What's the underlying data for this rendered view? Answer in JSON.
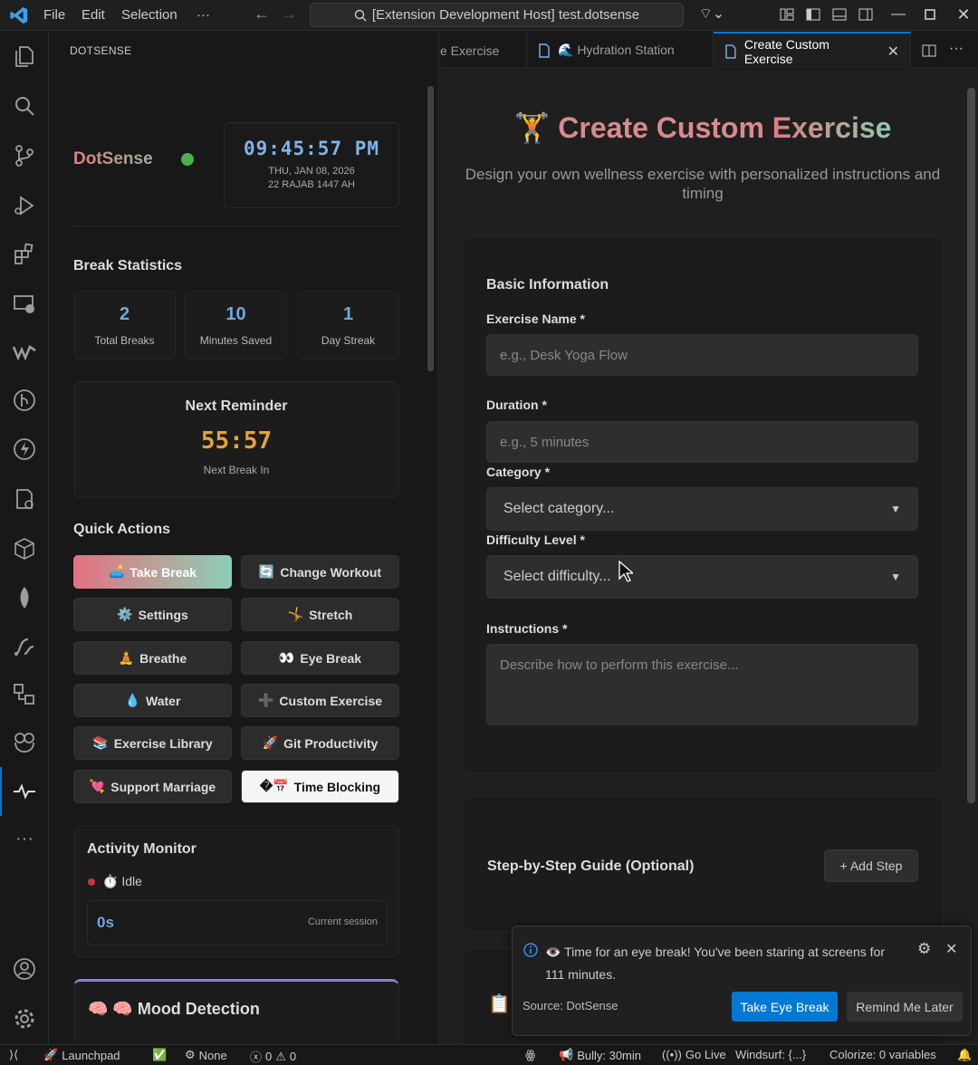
{
  "titlebar": {
    "menu": [
      "File",
      "Edit",
      "Selection",
      "···"
    ],
    "search": "[Extension Development Host] test.dotsense"
  },
  "sidebar": {
    "title": "DOTSENSE",
    "brand": "DotSense",
    "clock": {
      "time": "09:45:57 PM",
      "date": "THU, JAN 08, 2026",
      "hijri": "22 RAJAB 1447 AH"
    },
    "stats_title": "Break Statistics",
    "stats": [
      {
        "value": "2",
        "label": "Total Breaks"
      },
      {
        "value": "10",
        "label": "Minutes Saved"
      },
      {
        "value": "1",
        "label": "Day Streak"
      }
    ],
    "next": {
      "title": "Next Reminder",
      "countdown": "55:57",
      "sub": "Next Break In"
    },
    "quick_title": "Quick Actions",
    "quick": [
      {
        "icon": "🛋️",
        "label": "Take Break"
      },
      {
        "icon": "🔄",
        "label": "Change Workout"
      },
      {
        "icon": "⚙️",
        "label": "Settings"
      },
      {
        "icon": "🤸",
        "label": "Stretch"
      },
      {
        "icon": "🧘",
        "label": "Breathe"
      },
      {
        "icon": "👀",
        "label": "Eye Break"
      },
      {
        "icon": "💧",
        "label": "Water"
      },
      {
        "icon": "➕",
        "label": "Custom Exercise"
      },
      {
        "icon": "📚",
        "label": "Exercise Library"
      },
      {
        "icon": "🚀",
        "label": "Git Productivity"
      },
      {
        "icon": "💘",
        "label": "Support Marriage"
      },
      {
        "icon": "�📅",
        "label": "Time Blocking"
      }
    ],
    "activity": {
      "title": "Activity Monitor",
      "status": "⏱️ Idle",
      "session_value": "0s",
      "session_label": "Current session"
    },
    "mood_title": "🧠 🧠 Mood Detection"
  },
  "tabs": [
    {
      "label": "e Exercise"
    },
    {
      "label": "🌊 Hydration Station"
    },
    {
      "label": "Create Custom Exercise"
    }
  ],
  "editor": {
    "title_plain": "Create Custom ",
    "title_grad": "Exercise",
    "subtitle": "Design your own wellness exercise with personalized instructions and timing",
    "section": "Basic Information",
    "name_label": "Exercise Name *",
    "name_placeholder": "e.g., Desk Yoga Flow",
    "duration_label": "Duration *",
    "duration_placeholder": "e.g., 5 minutes",
    "category_label": "Category *",
    "category_value": "Select category...",
    "difficulty_label": "Difficulty Level *",
    "difficulty_value": "Select difficulty...",
    "instructions_label": "Instructions *",
    "instructions_placeholder": "Describe how to perform this exercise...",
    "steps_title": "Step-by-Step Guide (Optional)",
    "add_step": "+ Add Step"
  },
  "notification": {
    "message": "👁️ Time for an eye break! You've been staring at screens for 111 minutes.",
    "source": "Source: DotSense",
    "primary": "Take Eye Break",
    "secondary": "Remind Me Later"
  },
  "statusbar": {
    "launchpad": "Launchpad",
    "none": "None",
    "errors": "0",
    "warnings": "0",
    "bully": "Bully: 30min",
    "golive": "Go Live",
    "windsurf": "Windsurf: {...}",
    "colorize": "Colorize: 0 variables"
  },
  "colors": {
    "accent": "#0078d4",
    "brand_from": "#e5717f",
    "brand_to": "#8ccfb5"
  }
}
